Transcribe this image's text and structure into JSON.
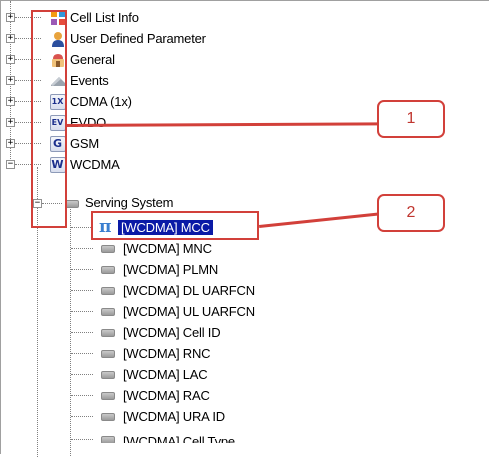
{
  "tree": {
    "top_items": [
      {
        "label": "Cell List Info",
        "icon": "cell-list-info-icon"
      },
      {
        "label": "User Defined Parameter",
        "icon": "user-icon"
      },
      {
        "label": "General",
        "icon": "general-icon"
      },
      {
        "label": "Events",
        "icon": "events-icon"
      },
      {
        "label": "CDMA (1x)",
        "icon": "cdma-badge-icon",
        "badge": "1X"
      },
      {
        "label": "EVDO",
        "icon": "evdo-badge-icon",
        "badge": "EV"
      },
      {
        "label": "GSM",
        "icon": "gsm-badge-icon",
        "badge": "G"
      },
      {
        "label": "WCDMA",
        "icon": "wcdma-badge-icon",
        "badge": "W"
      }
    ],
    "group": {
      "label": "Serving System",
      "expander": "−"
    },
    "expander_plus": "+",
    "expander_minus": "−",
    "selected_item": {
      "label": "[WCDMA] MCC",
      "icon_glyph": "π"
    },
    "leaf_items": [
      "[WCDMA] MNC",
      "[WCDMA] PLMN",
      "[WCDMA] DL UARFCN",
      "[WCDMA] UL UARFCN",
      "[WCDMA] Cell ID",
      "[WCDMA] RNC",
      "[WCDMA] LAC",
      "[WCDMA] RAC",
      "[WCDMA] URA ID",
      "[WCDMA] Cell Type"
    ]
  },
  "callouts": [
    {
      "number": "1"
    },
    {
      "number": "2"
    }
  ],
  "colors": {
    "selection": "#0a1aa6",
    "callout": "#d2403a",
    "badge_text": "#1b2f8c"
  }
}
